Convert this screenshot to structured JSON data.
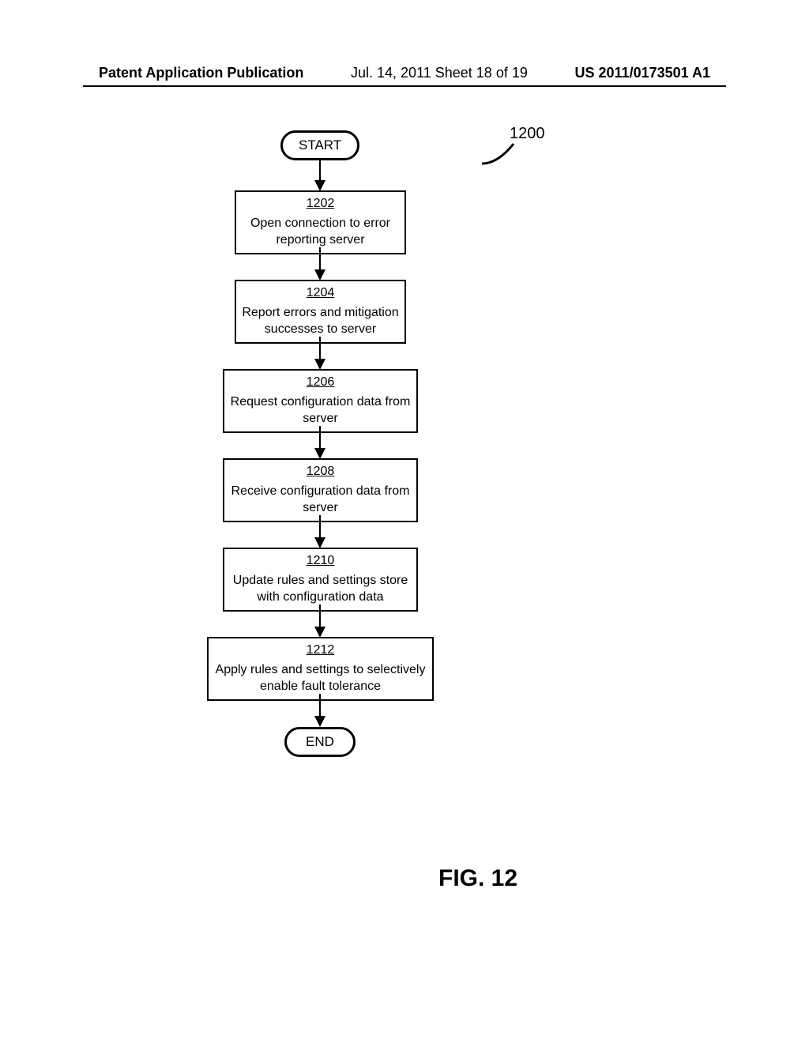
{
  "header": {
    "left": "Patent Application Publication",
    "center": "Jul. 14, 2011  Sheet 18 of 19",
    "right": "US 2011/0173501 A1"
  },
  "diagram": {
    "ref_label": "1200",
    "start": "START",
    "end": "END",
    "steps": [
      {
        "ref": "1202",
        "text": "Open connection to error reporting server"
      },
      {
        "ref": "1204",
        "text": "Report errors and mitigation successes to server"
      },
      {
        "ref": "1206",
        "text": "Request configuration data from server"
      },
      {
        "ref": "1208",
        "text": "Receive configuration data from server"
      },
      {
        "ref": "1210",
        "text": "Update rules and settings store with configuration data"
      },
      {
        "ref": "1212",
        "text": "Apply rules and settings to selectively enable fault tolerance"
      }
    ],
    "figure": "FIG. 12"
  }
}
